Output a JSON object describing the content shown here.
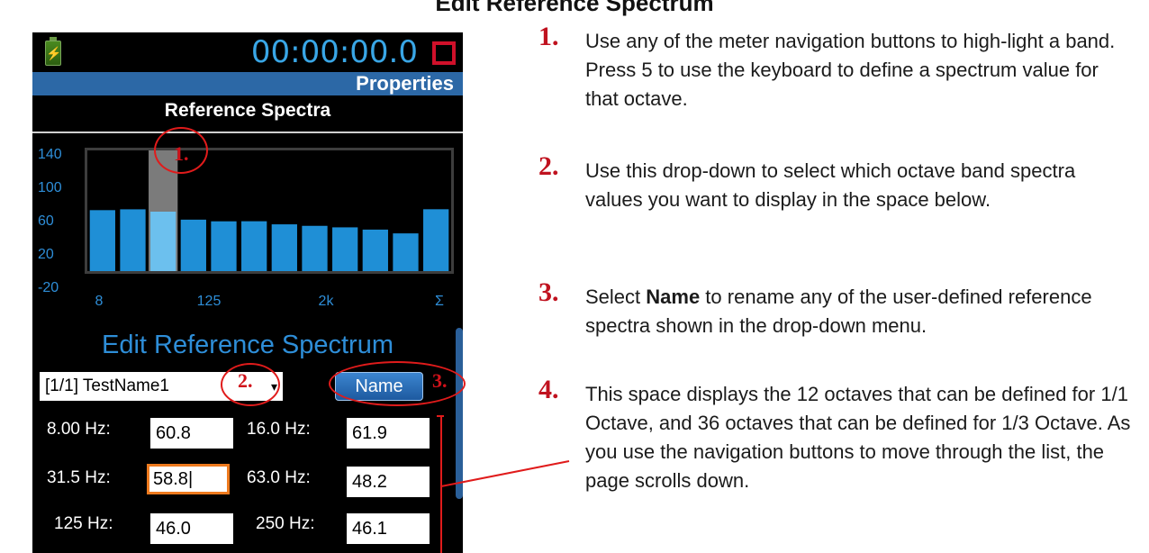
{
  "page": {
    "title": "Edit Reference Spectrum"
  },
  "device": {
    "timer": "00:00:00.0",
    "tab_label": "Properties",
    "screen_title": "Reference Spectra",
    "edit_title": "Edit Reference Spectrum",
    "dropdown_value": "[1/1] TestName1",
    "name_button_label": "Name",
    "bands": [
      {
        "label": "8.00 Hz:",
        "value": "60.8"
      },
      {
        "label": "16.0 Hz:",
        "value": "61.9"
      },
      {
        "label": "31.5 Hz:",
        "value": "58.8"
      },
      {
        "label": "63.0 Hz:",
        "value": "48.2"
      },
      {
        "label": "125 Hz:",
        "value": "46.0"
      },
      {
        "label": "250 Hz:",
        "value": "46.1"
      }
    ],
    "selected_band": "31.5 Hz:"
  },
  "chart_data": {
    "type": "bar",
    "ylim": [
      -20,
      140
    ],
    "y_ticks": [
      "140",
      "100",
      "60",
      "20",
      "-20"
    ],
    "x_tick_labels": [
      "8",
      "125",
      "2k",
      "Σ"
    ],
    "values": [
      60.8,
      61.9,
      58.8,
      48.2,
      46.0,
      46.1,
      42,
      40,
      38,
      35,
      30,
      62
    ],
    "highlighted_index": 2,
    "colors": {
      "bar": "#1f8fd6",
      "highlight": "#6cc0ee",
      "selection": "#7b7b7b"
    }
  },
  "callouts": [
    "1.",
    "2.",
    "3."
  ],
  "notes": [
    {
      "number": "1.",
      "text": "Use any of the meter navigation buttons to high-light a band. Press 5 to use the keyboard to define a spectrum value for that octave."
    },
    {
      "number": "2.",
      "text": "Use this drop-down to select which octave band spectra values you want to display in the space below."
    },
    {
      "number": "3.",
      "text_before": "Select ",
      "bold": "Name",
      "text_after": " to rename any of the user-defined reference spectra shown in the drop-down menu."
    },
    {
      "number": "4.",
      "text": "This space displays the 12 octaves that can be defined for 1/1 Octave, and 36 octaves that can be defined for 1/3 Octave. As you use the navigation buttons to move through the list, the page scrolls down."
    }
  ]
}
